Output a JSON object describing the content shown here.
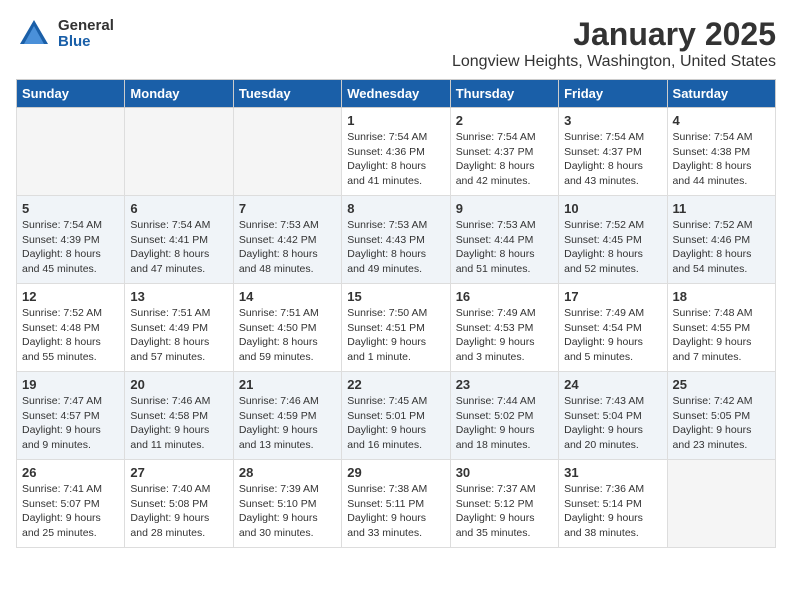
{
  "logo": {
    "general": "General",
    "blue": "Blue"
  },
  "title": "January 2025",
  "location": "Longview Heights, Washington, United States",
  "weekdays": [
    "Sunday",
    "Monday",
    "Tuesday",
    "Wednesday",
    "Thursday",
    "Friday",
    "Saturday"
  ],
  "weeks": [
    [
      {
        "day": "",
        "info": ""
      },
      {
        "day": "",
        "info": ""
      },
      {
        "day": "",
        "info": ""
      },
      {
        "day": "1",
        "info": "Sunrise: 7:54 AM\nSunset: 4:36 PM\nDaylight: 8 hours\nand 41 minutes."
      },
      {
        "day": "2",
        "info": "Sunrise: 7:54 AM\nSunset: 4:37 PM\nDaylight: 8 hours\nand 42 minutes."
      },
      {
        "day": "3",
        "info": "Sunrise: 7:54 AM\nSunset: 4:37 PM\nDaylight: 8 hours\nand 43 minutes."
      },
      {
        "day": "4",
        "info": "Sunrise: 7:54 AM\nSunset: 4:38 PM\nDaylight: 8 hours\nand 44 minutes."
      }
    ],
    [
      {
        "day": "5",
        "info": "Sunrise: 7:54 AM\nSunset: 4:39 PM\nDaylight: 8 hours\nand 45 minutes."
      },
      {
        "day": "6",
        "info": "Sunrise: 7:54 AM\nSunset: 4:41 PM\nDaylight: 8 hours\nand 47 minutes."
      },
      {
        "day": "7",
        "info": "Sunrise: 7:53 AM\nSunset: 4:42 PM\nDaylight: 8 hours\nand 48 minutes."
      },
      {
        "day": "8",
        "info": "Sunrise: 7:53 AM\nSunset: 4:43 PM\nDaylight: 8 hours\nand 49 minutes."
      },
      {
        "day": "9",
        "info": "Sunrise: 7:53 AM\nSunset: 4:44 PM\nDaylight: 8 hours\nand 51 minutes."
      },
      {
        "day": "10",
        "info": "Sunrise: 7:52 AM\nSunset: 4:45 PM\nDaylight: 8 hours\nand 52 minutes."
      },
      {
        "day": "11",
        "info": "Sunrise: 7:52 AM\nSunset: 4:46 PM\nDaylight: 8 hours\nand 54 minutes."
      }
    ],
    [
      {
        "day": "12",
        "info": "Sunrise: 7:52 AM\nSunset: 4:48 PM\nDaylight: 8 hours\nand 55 minutes."
      },
      {
        "day": "13",
        "info": "Sunrise: 7:51 AM\nSunset: 4:49 PM\nDaylight: 8 hours\nand 57 minutes."
      },
      {
        "day": "14",
        "info": "Sunrise: 7:51 AM\nSunset: 4:50 PM\nDaylight: 8 hours\nand 59 minutes."
      },
      {
        "day": "15",
        "info": "Sunrise: 7:50 AM\nSunset: 4:51 PM\nDaylight: 9 hours\nand 1 minute."
      },
      {
        "day": "16",
        "info": "Sunrise: 7:49 AM\nSunset: 4:53 PM\nDaylight: 9 hours\nand 3 minutes."
      },
      {
        "day": "17",
        "info": "Sunrise: 7:49 AM\nSunset: 4:54 PM\nDaylight: 9 hours\nand 5 minutes."
      },
      {
        "day": "18",
        "info": "Sunrise: 7:48 AM\nSunset: 4:55 PM\nDaylight: 9 hours\nand 7 minutes."
      }
    ],
    [
      {
        "day": "19",
        "info": "Sunrise: 7:47 AM\nSunset: 4:57 PM\nDaylight: 9 hours\nand 9 minutes."
      },
      {
        "day": "20",
        "info": "Sunrise: 7:46 AM\nSunset: 4:58 PM\nDaylight: 9 hours\nand 11 minutes."
      },
      {
        "day": "21",
        "info": "Sunrise: 7:46 AM\nSunset: 4:59 PM\nDaylight: 9 hours\nand 13 minutes."
      },
      {
        "day": "22",
        "info": "Sunrise: 7:45 AM\nSunset: 5:01 PM\nDaylight: 9 hours\nand 16 minutes."
      },
      {
        "day": "23",
        "info": "Sunrise: 7:44 AM\nSunset: 5:02 PM\nDaylight: 9 hours\nand 18 minutes."
      },
      {
        "day": "24",
        "info": "Sunrise: 7:43 AM\nSunset: 5:04 PM\nDaylight: 9 hours\nand 20 minutes."
      },
      {
        "day": "25",
        "info": "Sunrise: 7:42 AM\nSunset: 5:05 PM\nDaylight: 9 hours\nand 23 minutes."
      }
    ],
    [
      {
        "day": "26",
        "info": "Sunrise: 7:41 AM\nSunset: 5:07 PM\nDaylight: 9 hours\nand 25 minutes."
      },
      {
        "day": "27",
        "info": "Sunrise: 7:40 AM\nSunset: 5:08 PM\nDaylight: 9 hours\nand 28 minutes."
      },
      {
        "day": "28",
        "info": "Sunrise: 7:39 AM\nSunset: 5:10 PM\nDaylight: 9 hours\nand 30 minutes."
      },
      {
        "day": "29",
        "info": "Sunrise: 7:38 AM\nSunset: 5:11 PM\nDaylight: 9 hours\nand 33 minutes."
      },
      {
        "day": "30",
        "info": "Sunrise: 7:37 AM\nSunset: 5:12 PM\nDaylight: 9 hours\nand 35 minutes."
      },
      {
        "day": "31",
        "info": "Sunrise: 7:36 AM\nSunset: 5:14 PM\nDaylight: 9 hours\nand 38 minutes."
      },
      {
        "day": "",
        "info": ""
      }
    ]
  ]
}
